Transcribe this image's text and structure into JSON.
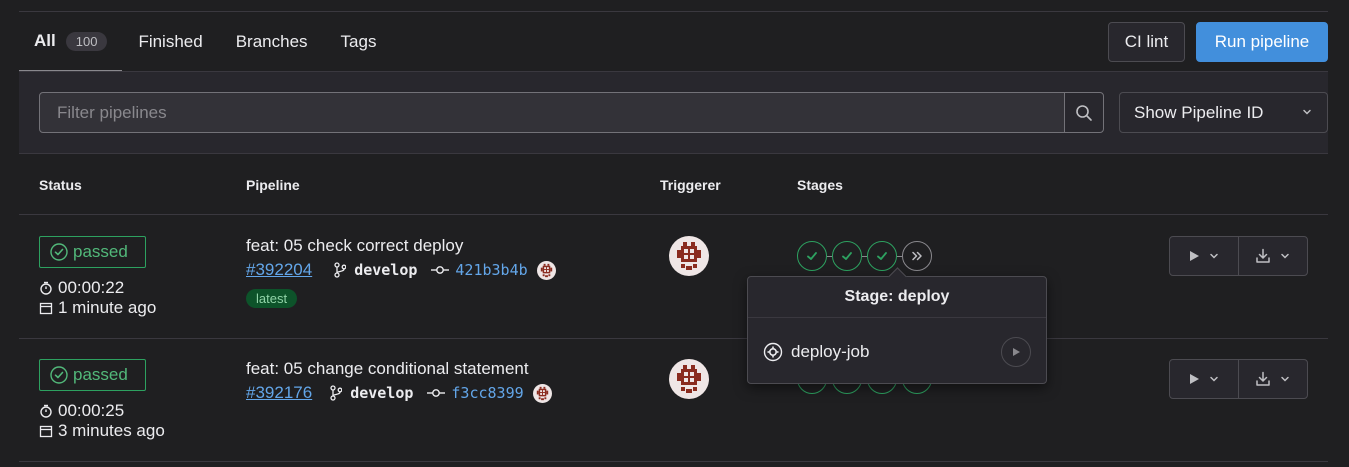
{
  "tabs": [
    {
      "label": "All",
      "count": "100",
      "active": true
    },
    {
      "label": "Finished"
    },
    {
      "label": "Branches"
    },
    {
      "label": "Tags"
    }
  ],
  "buttons": {
    "ci_lint": "CI lint",
    "run_pipeline": "Run pipeline"
  },
  "filter": {
    "placeholder": "Filter pipelines",
    "select_label": "Show Pipeline ID"
  },
  "table": {
    "headers": {
      "status": "Status",
      "pipeline": "Pipeline",
      "triggerer": "Triggerer",
      "stages": "Stages"
    },
    "rows": [
      {
        "status": "passed",
        "duration": "00:00:22",
        "finished": "1 minute ago",
        "title": "feat: 05 check correct deploy",
        "id": "#392204",
        "branch": "develop",
        "sha": "421b3b4b",
        "badge": "latest",
        "stages": [
          "success",
          "success",
          "success",
          "skipped"
        ]
      },
      {
        "status": "passed",
        "duration": "00:00:25",
        "finished": "3 minutes ago",
        "title": "feat: 05 change conditional statement",
        "id": "#392176",
        "branch": "develop",
        "sha": "f3cc8399",
        "stages": [
          "success",
          "success",
          "success",
          "success"
        ]
      }
    ]
  },
  "popover": {
    "title": "Stage: deploy",
    "job": "deploy-job"
  },
  "colors": {
    "success": "#2da160",
    "accent": "#428fdc",
    "link": "#63a6e9",
    "background": "#1f1f21"
  }
}
